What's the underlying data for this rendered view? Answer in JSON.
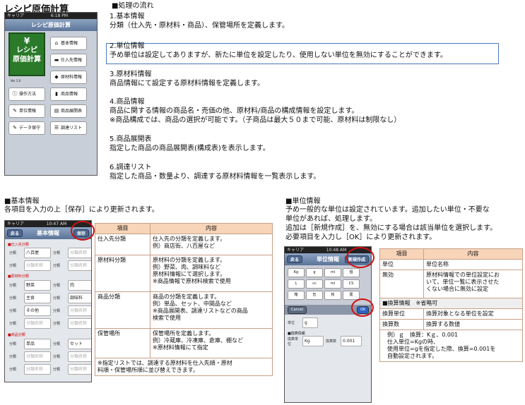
{
  "app_title": "レシピ原価計算",
  "phone_status": {
    "carrier": "キャリア",
    "time1": "6:18 PM",
    "time2": "10:47 AM",
    "time3": "10:48 AM"
  },
  "menu_screen": {
    "nav_title": "レシピ原価計算",
    "logo_lines": [
      "レシピ",
      "原価計算"
    ],
    "logo_glyph": "¥",
    "version": "Ver 1.0",
    "buttons": [
      "基本情報",
      "仕入先情報",
      "原材料情報",
      "操作方法",
      "商品情報",
      "単位情報",
      "商品展開表",
      "データ保守",
      "調達リスト"
    ]
  },
  "flow": {
    "heading": "■処理の流れ",
    "items": [
      {
        "title": "1.基本情報",
        "lines": [
          "分類（仕入先・原材料・商品）、保管場所を定義します。"
        ]
      },
      {
        "title": "2.単位情報",
        "lines": [
          "予め単位は設定してありますが、新たに単位を設定したり、使用しない単位を無効にすることができます。"
        ]
      },
      {
        "title": "3.原材料情報",
        "lines": [
          "商品情報にて設定する原材料情報を定義します。"
        ]
      },
      {
        "title": "4.商品情報",
        "lines": [
          "商品に関する情報の商品名・売価の他、原材料/商品の構成情報を設定します。",
          "※商品構成では、商品の選択が可能です。（子商品は最大５０まで可能、原材料は制限なし）"
        ]
      },
      {
        "title": "5.商品展開表",
        "lines": [
          "指定した商品の商品展開表(構成表)を表示します。"
        ]
      },
      {
        "title": "6.調達リスト",
        "lines": [
          "指定した商品・数量より、調達する原材料情報を一覧表示します。"
        ]
      }
    ]
  },
  "basic": {
    "heading": "■基本情報",
    "desc": "各項目を入力の上［保存］により更新されます。",
    "screen": {
      "nav_title": "基本情報",
      "back": "戻る",
      "save": "保存",
      "section1": "■仕入先分類",
      "section2": "■原材料分類",
      "section3": "■商品分類",
      "label": "分類",
      "placeholder": "分類名称",
      "rows1": [
        [
          "八百屋",
          ""
        ],
        [
          "",
          ""
        ]
      ],
      "rows2": [
        [
          "野菜",
          "肉"
        ],
        [
          "主食",
          "調味料"
        ],
        [
          "その他",
          ""
        ],
        [
          "",
          ""
        ]
      ],
      "rows3": [
        [
          "単品",
          "セット"
        ],
        [
          "",
          ""
        ],
        [
          "",
          ""
        ]
      ]
    },
    "table": {
      "headers": [
        "項目",
        "内容"
      ],
      "rows": [
        [
          "仕入先分類",
          "仕入先の分類を定義します。\n例）商店街、八百屋など"
        ],
        [
          "原材料分類",
          "原材料の分類を定義します。\n例）野菜、肉、調味料など\n原材料情報にて選択します。\n※商品情報で原材料検索で使用"
        ],
        [
          "商品分類",
          "商品の分類を定義します。\n例）単品、セット、中間品など\n※商品展開表、調達リストなどの商品\n検索で使用"
        ],
        [
          "保管場所",
          "保管場所を定義します。\n例）冷蔵庫、冷凍庫、倉庫、棚など\n※原材料情報にて指定"
        ]
      ],
      "note": "※指定リストでは、調達する原材料を仕入先順・原材\n料順・保管場所順に並び替えできます。"
    }
  },
  "unit": {
    "heading": "■単位情報",
    "desc_lines": [
      "予め一般的な単位は設定されています。追加したい単位・不要な",
      "単位があれば、処理します。",
      "追加は［新規作成］を、無効にする場合は該当単位を選択します。",
      "必要項目を入力し［OK］により更新されます。"
    ],
    "screen": {
      "nav_title": "単位情報",
      "back": "戻る",
      "new": "新規作成",
      "keys": [
        "Kg",
        "g",
        "ml",
        "個",
        "L",
        "cc",
        "ml",
        "束",
        "CS",
        "箱",
        "缶",
        "枚",
        "袋",
        "尾",
        "台",
        "本",
        "匹",
        "瓶"
      ],
      "cancel": "Cancel",
      "ok": "OK",
      "unit_label": "単位",
      "unit_value": "g",
      "conv_section": "■換算情報",
      "conv_unit_label": "換算単位",
      "conv_unit_value": "Kg",
      "conv_num_label": "換算数",
      "conv_num_value": "0.001"
    },
    "table": {
      "headers": [
        "項目",
        "内容"
      ],
      "rows": [
        [
          "単位",
          "単位名称"
        ],
        [
          "無効",
          "原材料情報での単位設定にお\nいて、単位一覧に表示させた\nくない場合に無効に設定"
        ]
      ],
      "conv_header": "■換算情報　※省略可",
      "conv_rows": [
        [
          "換算単位",
          "換算対象となる単位を設定"
        ],
        [
          "換算数",
          "換算する数値"
        ]
      ],
      "note": "例）ｇ　換算：Kｇ、0.001\n仕入単位=Kgの時、\n使用単位=gを指定した際、換算=0.001を\n自動設定されます。"
    }
  }
}
